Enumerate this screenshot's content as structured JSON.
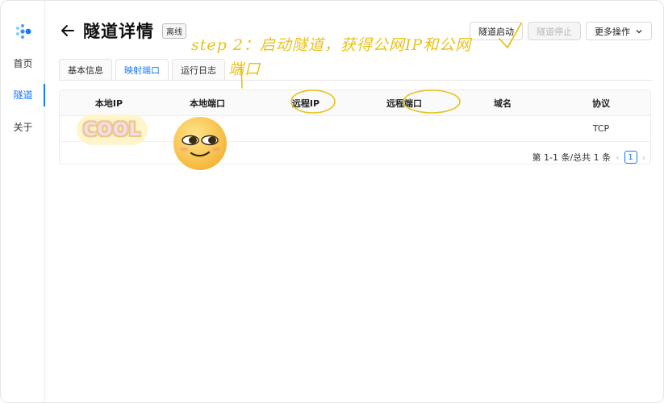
{
  "window": {
    "controls": [
      "close",
      "minimize",
      "maximize"
    ]
  },
  "sidebar": {
    "logo_icon": "app-logo-icon",
    "items": [
      {
        "label": "首页",
        "active": false
      },
      {
        "label": "隧道",
        "active": true
      },
      {
        "label": "关于",
        "active": false
      }
    ]
  },
  "header": {
    "back_icon": "arrow-left-icon",
    "title": "隧道详情",
    "status_badge": "离线"
  },
  "actions": {
    "start_label": "隧道启动",
    "stop_label": "隧道停止",
    "more_label": "更多操作",
    "more_icon": "chevron-down-icon"
  },
  "tabs": [
    {
      "label": "基本信息",
      "active": false
    },
    {
      "label": "映射端口",
      "active": true
    },
    {
      "label": "运行日志",
      "active": false
    }
  ],
  "table": {
    "columns": [
      "本地IP",
      "本地端口",
      "远程IP",
      "远程端口",
      "域名",
      "协议"
    ],
    "rows": [
      [
        "",
        "",
        "",
        "",
        "",
        "TCP"
      ]
    ]
  },
  "pagination": {
    "summary": "第 1-1 条/总共 1 条",
    "current_page": "1",
    "prev_icon": "chevron-left-icon",
    "next_icon": "chevron-right-icon"
  },
  "annotations": {
    "handwritten_note_line1": "step 2：启动隧道，获得公网IP和公网",
    "handwritten_note_line2": "端口",
    "sticker_text": "COOL",
    "emoji": "smug-face-emoji",
    "ink_color": "#e8c21a"
  },
  "colors": {
    "accent": "#1677ff",
    "border": "#e6e6e6"
  }
}
